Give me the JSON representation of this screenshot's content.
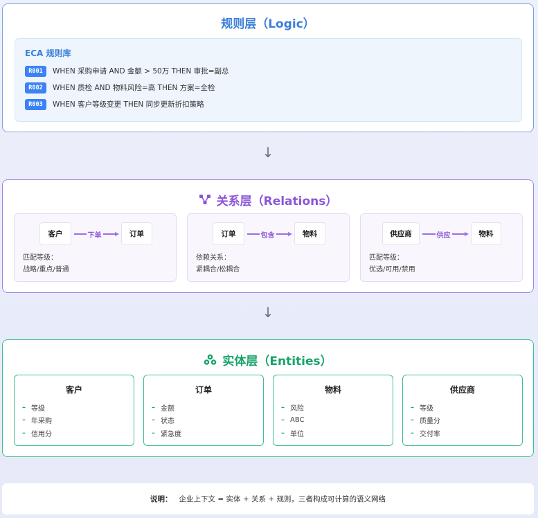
{
  "logic": {
    "title": "规则层（Logic）",
    "rulebase_title": "ECA 规则库",
    "rules": [
      {
        "id": "R001",
        "text": "WHEN 采购申请 AND 金额 > 50万 THEN 审批=副总"
      },
      {
        "id": "R002",
        "text": "WHEN 质检 AND 物料风险=高 THEN 方案=全检"
      },
      {
        "id": "R003",
        "text": "WHEN 客户等级变更 THEN 同步更新折扣策略"
      }
    ]
  },
  "arrow": "↓",
  "relations": {
    "title": "关系层（Relations）",
    "icon": "network-icon",
    "items": [
      {
        "from": "客户",
        "edge": "下单",
        "to": "订单",
        "desc_label": "匹配等级：",
        "desc_value": "战略/重点/普通"
      },
      {
        "from": "订单",
        "edge": "包含",
        "to": "物料",
        "desc_label": "依赖关系：",
        "desc_value": "紧耦合/松耦合"
      },
      {
        "from": "供应商",
        "edge": "供应",
        "to": "物料",
        "desc_label": "匹配等级：",
        "desc_value": "优选/可用/禁用"
      }
    ]
  },
  "entities": {
    "title": "实体层（Entities）",
    "icon": "cubes-icon",
    "items": [
      {
        "name": "客户",
        "attrs": [
          "等级",
          "年采购",
          "信用分"
        ]
      },
      {
        "name": "订单",
        "attrs": [
          "金额",
          "状态",
          "紧急度"
        ]
      },
      {
        "name": "物料",
        "attrs": [
          "风险",
          "ABC",
          "单位"
        ]
      },
      {
        "name": "供应商",
        "attrs": [
          "等级",
          "质量分",
          "交付率"
        ]
      }
    ]
  },
  "note": {
    "label": "说明：",
    "text": "企业上下文 = 实体 + 关系 + 规则，三者构成可计算的语义网络"
  },
  "colors": {
    "logic": "#3b7fd8",
    "relations": "#8a55d8",
    "entities": "#16a36a"
  }
}
